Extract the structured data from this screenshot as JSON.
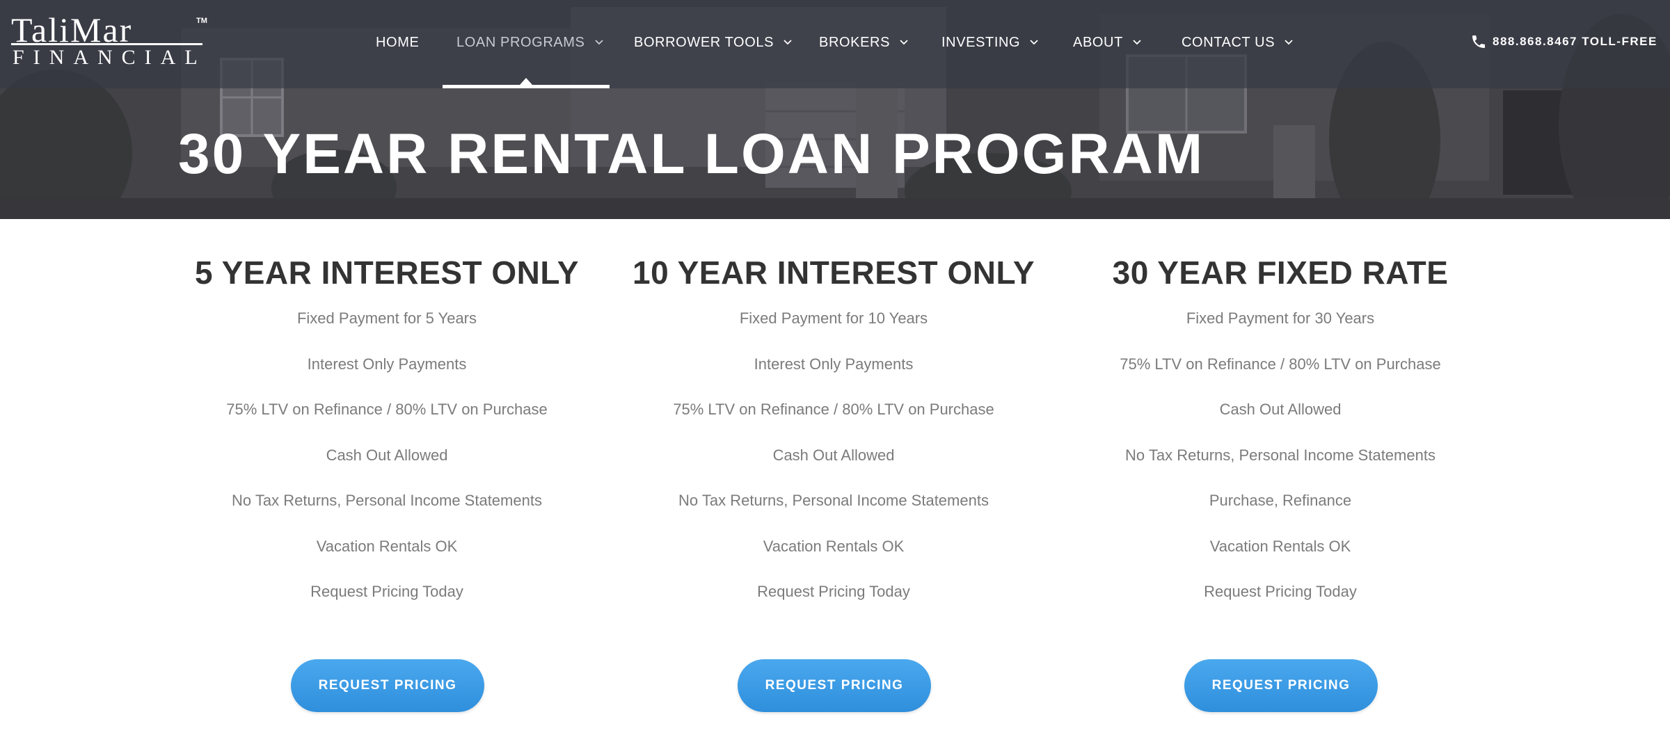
{
  "brand": {
    "logo_top": "TaliMar",
    "logo_bottom": "FINANCIAL",
    "trademark": "TM"
  },
  "nav": {
    "items": [
      {
        "label": "HOME",
        "has_dropdown": false,
        "active": false
      },
      {
        "label": "LOAN PROGRAMS",
        "has_dropdown": true,
        "active": true
      },
      {
        "label": "BORROWER TOOLS",
        "has_dropdown": true,
        "active": false
      },
      {
        "label": "BROKERS",
        "has_dropdown": true,
        "active": false
      },
      {
        "label": "INVESTING",
        "has_dropdown": true,
        "active": false
      },
      {
        "label": "ABOUT",
        "has_dropdown": true,
        "active": false
      },
      {
        "label": "CONTACT US",
        "has_dropdown": true,
        "active": false
      }
    ],
    "phone": "888.868.8467 TOLL-FREE",
    "phone_icon": "phone-icon"
  },
  "hero": {
    "title": "30 YEAR RENTAL LOAN PROGRAM"
  },
  "programs": [
    {
      "title": "5 YEAR INTEREST ONLY",
      "features": [
        "Fixed Payment for 5 Years",
        "Interest Only Payments",
        "75% LTV on Refinance / 80% LTV on Purchase",
        "Cash Out Allowed",
        "No Tax Returns, Personal Income Statements",
        "Vacation Rentals OK",
        "Request Pricing Today"
      ],
      "button": "REQUEST PRICING"
    },
    {
      "title": "10 YEAR INTEREST ONLY",
      "features": [
        "Fixed Payment for 10 Years",
        "Interest Only Payments",
        "75% LTV on Refinance / 80% LTV on Purchase",
        "Cash Out Allowed",
        "No Tax Returns, Personal Income Statements",
        "Vacation Rentals OK",
        "Request Pricing Today"
      ],
      "button": "REQUEST PRICING"
    },
    {
      "title": "30 YEAR FIXED RATE",
      "features": [
        "Fixed Payment for 30 Years",
        "75% LTV on Refinance / 80% LTV on Purchase",
        "Cash Out Allowed",
        "No Tax Returns, Personal Income Statements",
        "Purchase, Refinance",
        "Vacation Rentals OK",
        "Request Pricing Today"
      ],
      "button": "REQUEST PRICING"
    }
  ],
  "colors": {
    "nav_bg": "#343842",
    "heading": "#333333",
    "body_text": "#7b7b7b",
    "button": "#3a9be6",
    "button_text": "#ffffff"
  }
}
